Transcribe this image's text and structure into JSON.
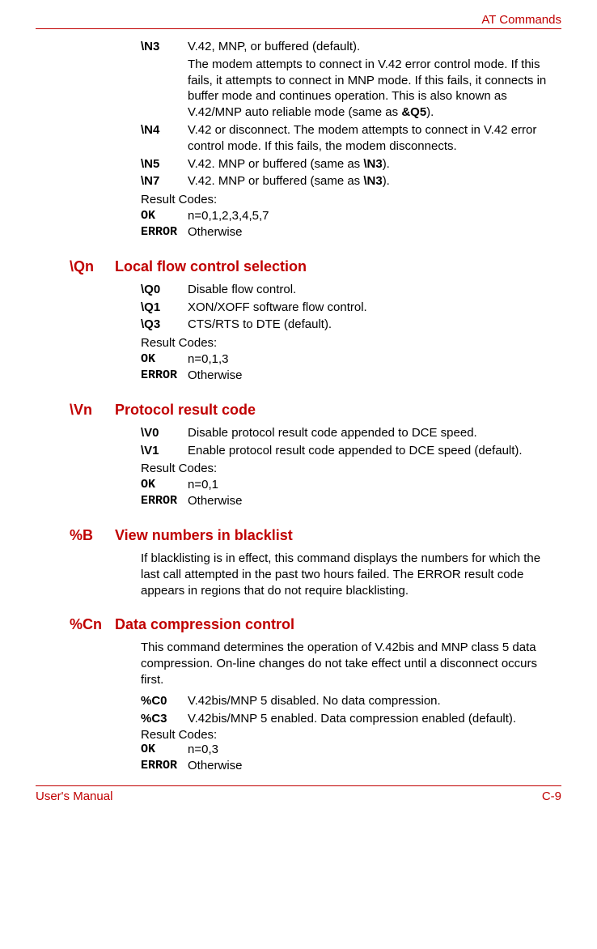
{
  "header": {
    "right": "AT Commands"
  },
  "footer": {
    "left": "User's Manual",
    "right": "C-9"
  },
  "n3": {
    "key": "\\N3",
    "line1": "V.42, MNP, or buffered (default).",
    "line2a": "The modem attempts to connect in V.42 error control mode. If this fails, it attempts to connect in MNP mode. If this fails, it connects in buffer mode and continues operation. This is also known as V.42/MNP auto reliable mode (same as ",
    "line2b": "&Q5",
    "line2c": ")."
  },
  "n4": {
    "key": "\\N4",
    "val": "V.42 or disconnect. The modem attempts to connect in V.42 error control mode. If this fails, the modem disconnects."
  },
  "n5": {
    "key": "\\N5",
    "pre": "V.42. MNP or buffered (same as ",
    "bold": "\\N3",
    "post": ")."
  },
  "n7": {
    "key": "\\N7",
    "pre": "V.42. MNP or buffered (same as ",
    "bold": "\\N3",
    "post": ")."
  },
  "nres": {
    "label": "Result Codes:",
    "ok": "OK",
    "okval": "n=0,1,2,3,4,5,7",
    "err": "ERROR",
    "errval": "Otherwise"
  },
  "qn": {
    "cmd": "\\Qn",
    "title": "Local flow control selection",
    "q0": {
      "key": "\\Q0",
      "val": "Disable flow control."
    },
    "q1": {
      "key": "\\Q1",
      "val": "XON/XOFF software flow control."
    },
    "q3": {
      "key": "\\Q3",
      "val": "CTS/RTS to DTE (default)."
    },
    "res": {
      "label": "Result Codes:",
      "ok": "OK",
      "okval": "n=0,1,3",
      "err": "ERROR",
      "errval": "Otherwise"
    }
  },
  "vn": {
    "cmd": "\\Vn",
    "title": "Protocol result code",
    "v0": {
      "key": "\\V0",
      "val": "Disable protocol result code appended to DCE speed."
    },
    "v1": {
      "key": "\\V1",
      "val": "Enable protocol result code appended to DCE speed (default)."
    },
    "res": {
      "label": "Result Codes:",
      "ok": "OK",
      "okval": "n=0,1",
      "err": "ERROR",
      "errval": "Otherwise"
    }
  },
  "pb": {
    "cmd": "%B",
    "title": "View numbers in blacklist",
    "text": "If blacklisting is in effect, this command displays the numbers for which the last call attempted in the past two hours failed. The ERROR result code appears in regions that do not require blacklisting."
  },
  "pc": {
    "cmd": "%Cn",
    "title": "Data compression control",
    "text": "This command determines the operation of V.42bis and MNP class 5 data compression. On-line changes do not take effect until a disconnect occurs first.",
    "c0": {
      "key": "%C0",
      "val": "V.42bis/MNP 5 disabled. No data compression."
    },
    "c3": {
      "key": "%C3",
      "val": "V.42bis/MNP 5 enabled. Data compression enabled (default)."
    },
    "res": {
      "label": "Result Codes:",
      "ok": "OK",
      "okval": "n=0,3",
      "err": "ERROR",
      "errval": "Otherwise"
    }
  }
}
